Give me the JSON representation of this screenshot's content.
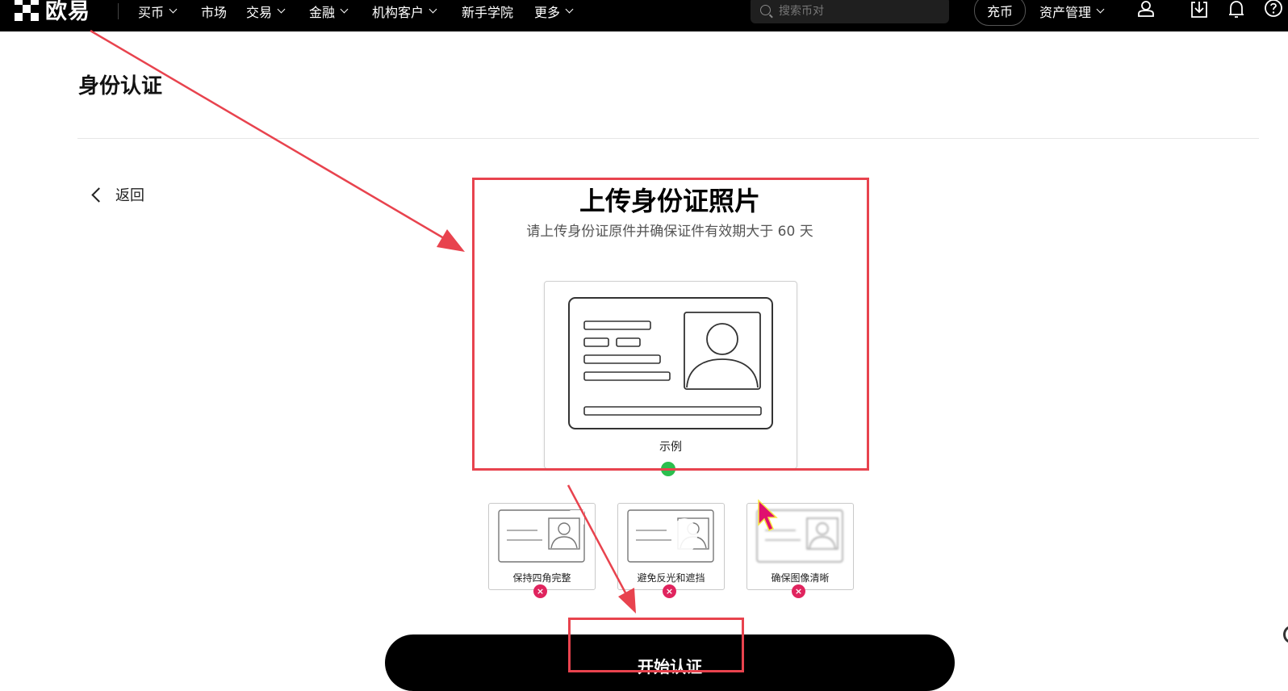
{
  "nav": {
    "logo_text": "欧易",
    "items": [
      {
        "label": "买币",
        "has_dropdown": true
      },
      {
        "label": "市场",
        "has_dropdown": false
      },
      {
        "label": "交易",
        "has_dropdown": true
      },
      {
        "label": "金融",
        "has_dropdown": true
      },
      {
        "label": "机构客户",
        "has_dropdown": true
      },
      {
        "label": "新手学院",
        "has_dropdown": false
      },
      {
        "label": "更多",
        "has_dropdown": true
      }
    ],
    "search_placeholder": "搜索币对",
    "deposit_label": "充币",
    "asset_label": "资产管理",
    "icons": [
      "user-icon",
      "download-icon",
      "bell-icon",
      "help-icon"
    ]
  },
  "page": {
    "title": "身份认证",
    "back_label": "返回"
  },
  "upload": {
    "title": "上传身份证照片",
    "subtitle": "请上传身份证原件并确保证件有效期大于 60 天",
    "example_label": "示例"
  },
  "tips": [
    {
      "label": "保持四角完整",
      "status": "error"
    },
    {
      "label": "避免反光和遮挡",
      "status": "error"
    },
    {
      "label": "确保图像清晰",
      "status": "error"
    }
  ],
  "start_button": {
    "label": "开始认证"
  },
  "colors": {
    "nav_bg": "#000000",
    "annotation_red": "#e8434e",
    "success_green": "#2bbf4e",
    "error_pink": "#e0245e",
    "cursor_magenta": "#e0106e"
  }
}
